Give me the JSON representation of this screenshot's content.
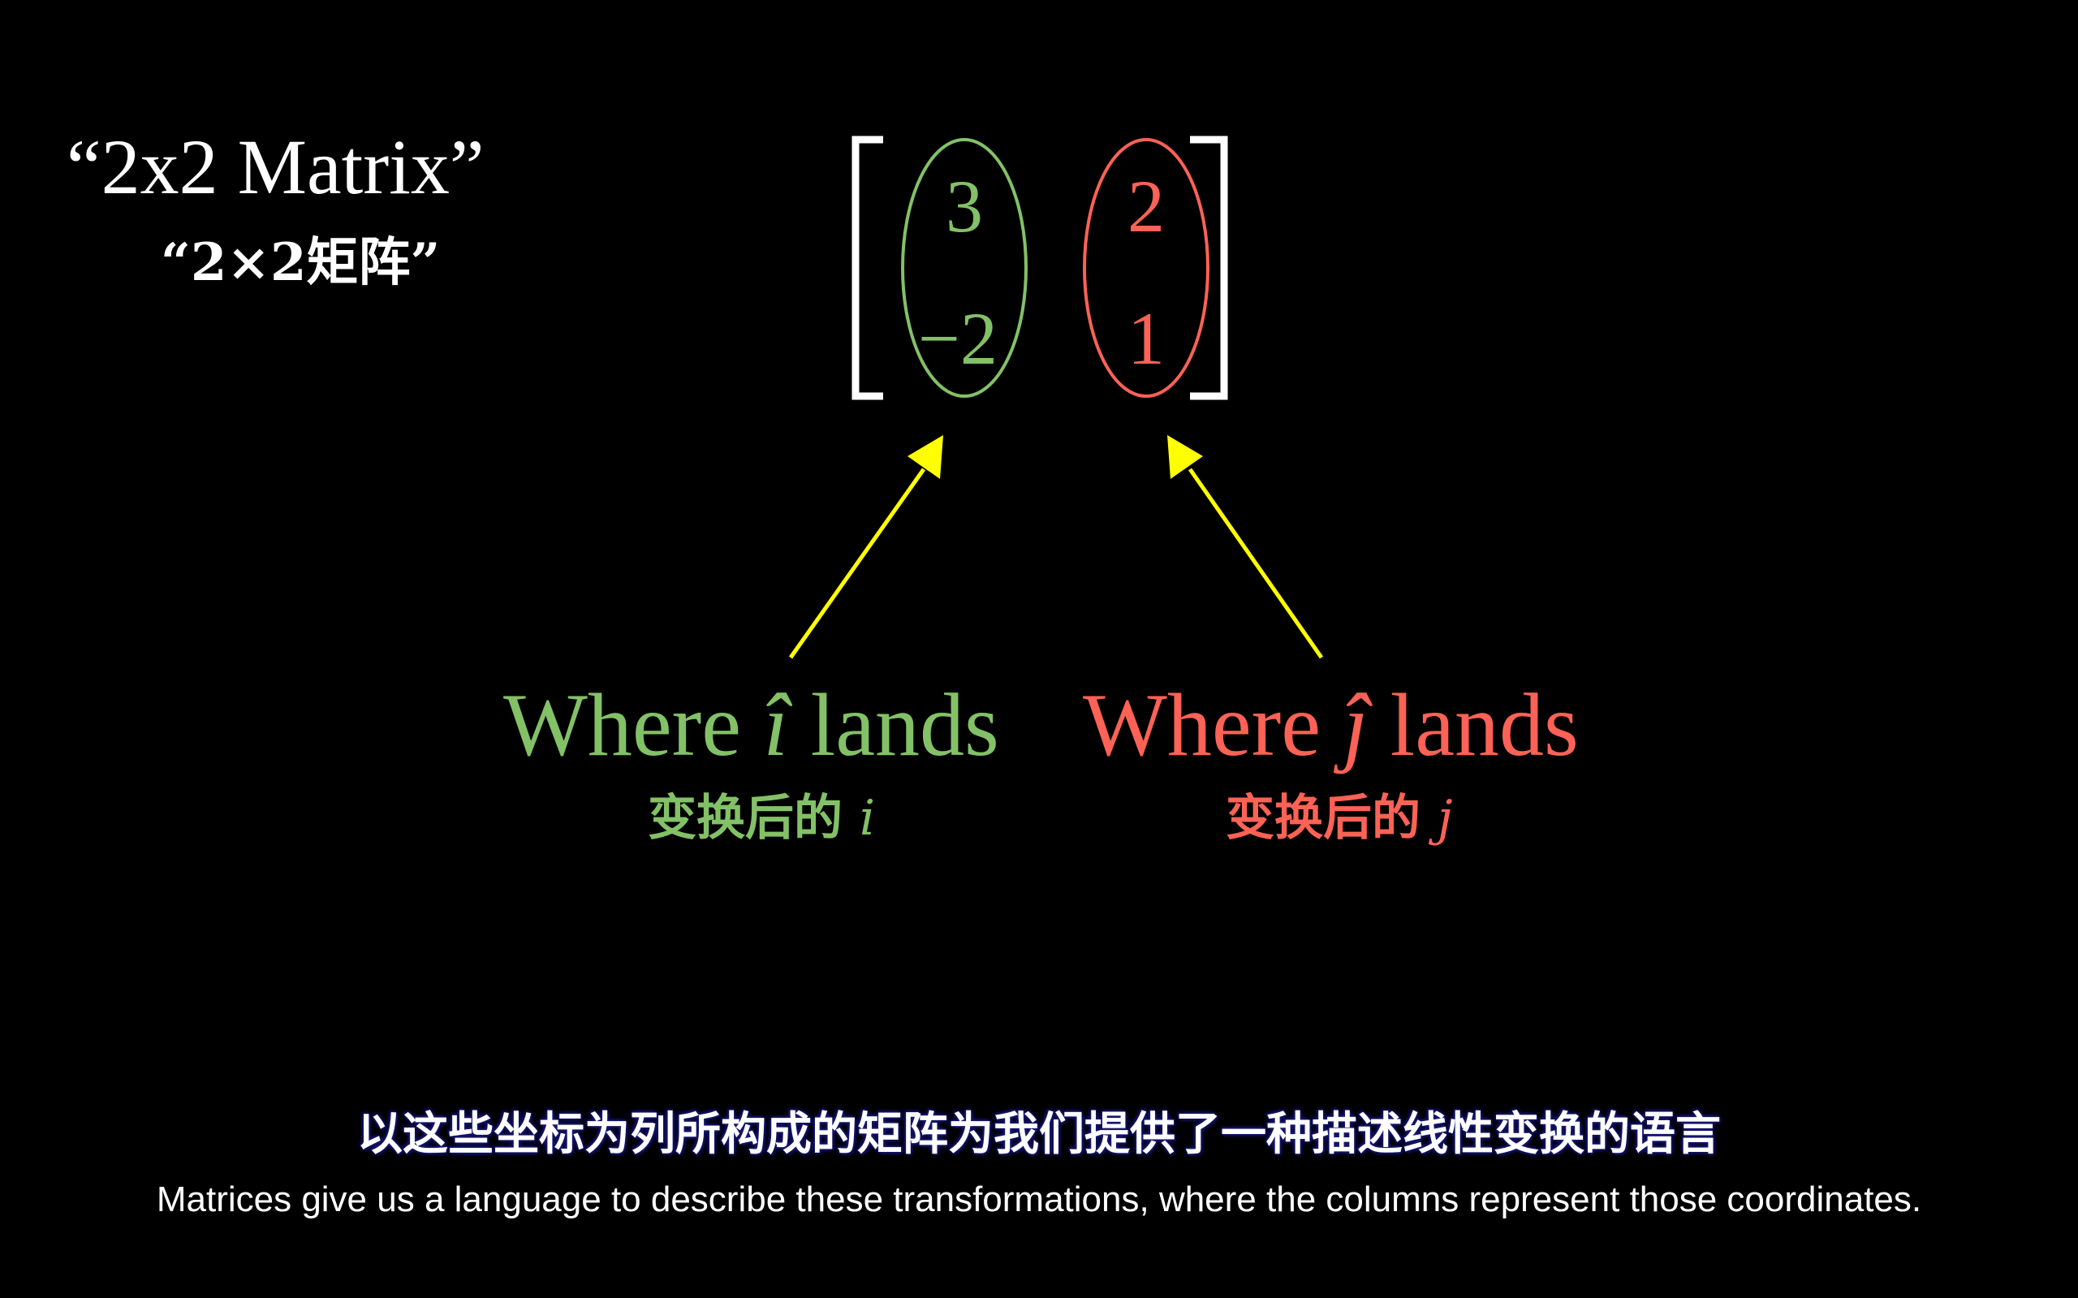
{
  "title": {
    "en": "“2x2 Matrix”",
    "zh": "“2×2矩阵”"
  },
  "matrix": {
    "col1": [
      "3",
      "−2"
    ],
    "col2": [
      "2",
      "1"
    ]
  },
  "labels": {
    "i_en_prefix": "Where ",
    "i_symbol": "î",
    "i_en_suffix": " lands",
    "j_en_prefix": "Where ",
    "j_symbol": "ĵ",
    "j_en_suffix": " lands",
    "i_zh": "变换后的",
    "i_var": "i",
    "j_zh": "变换后的",
    "j_var": "j"
  },
  "colors": {
    "background": "#000000",
    "i_hat": "#83c167",
    "j_hat": "#fc6255",
    "arrow": "#ffff00",
    "text": "#ffffff"
  },
  "subtitles": {
    "zh": "以这些坐标为列所构成的矩阵为我们提供了一种描述线性变换的语言",
    "en": "Matrices give us a language to describe these transformations, where the columns represent those coordinates."
  }
}
